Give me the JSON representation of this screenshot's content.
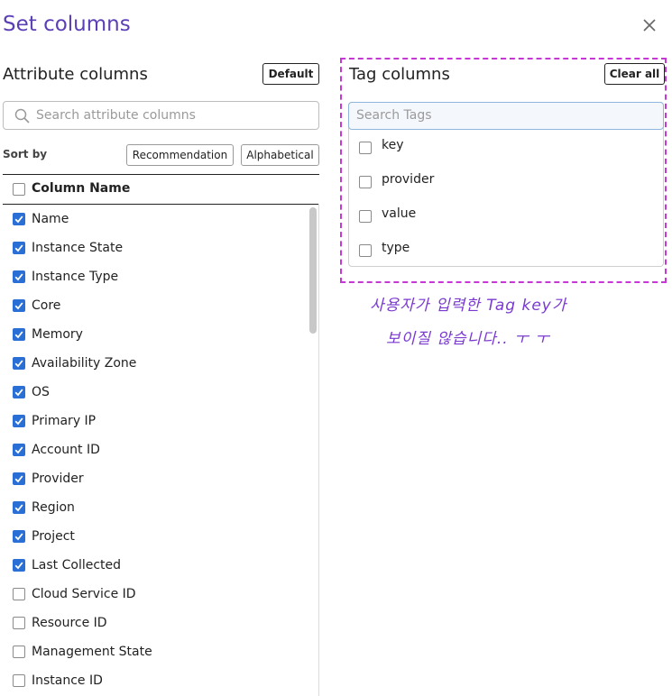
{
  "dialog": {
    "title": "Set columns"
  },
  "attribute": {
    "title": "Attribute columns",
    "default_label": "Default",
    "search_placeholder": "Search attribute columns",
    "sort_by_label": "Sort by",
    "sort_options": [
      "Recommendation",
      "Alphabetical"
    ],
    "header": "Column Name",
    "rows": [
      {
        "label": "Name",
        "checked": true
      },
      {
        "label": "Instance State",
        "checked": true
      },
      {
        "label": "Instance Type",
        "checked": true
      },
      {
        "label": "Core",
        "checked": true
      },
      {
        "label": "Memory",
        "checked": true
      },
      {
        "label": "Availability Zone",
        "checked": true
      },
      {
        "label": "OS",
        "checked": true
      },
      {
        "label": "Primary IP",
        "checked": true
      },
      {
        "label": "Account ID",
        "checked": true
      },
      {
        "label": "Provider",
        "checked": true
      },
      {
        "label": "Region",
        "checked": true
      },
      {
        "label": "Project",
        "checked": true
      },
      {
        "label": "Last Collected",
        "checked": true
      },
      {
        "label": "Cloud Service ID",
        "checked": false
      },
      {
        "label": "Resource ID",
        "checked": false
      },
      {
        "label": "Management State",
        "checked": false
      },
      {
        "label": "Instance ID",
        "checked": false
      }
    ]
  },
  "tags": {
    "title": "Tag columns",
    "clear_label": "Clear all",
    "search_placeholder": "Search Tags",
    "items": [
      {
        "label": "key",
        "checked": false
      },
      {
        "label": "provider",
        "checked": false
      },
      {
        "label": "value",
        "checked": false
      },
      {
        "label": "type",
        "checked": false
      }
    ]
  },
  "annotation": {
    "line1": "사용자가 입력한 Tag key가",
    "line2": "보이질 않습니다..  ㅜ ㅜ"
  },
  "colors": {
    "title": "#5b3fb5",
    "checkbox": "#2a6fd6",
    "highlight": "#c637d6",
    "handwriting": "#7a3ad0"
  }
}
